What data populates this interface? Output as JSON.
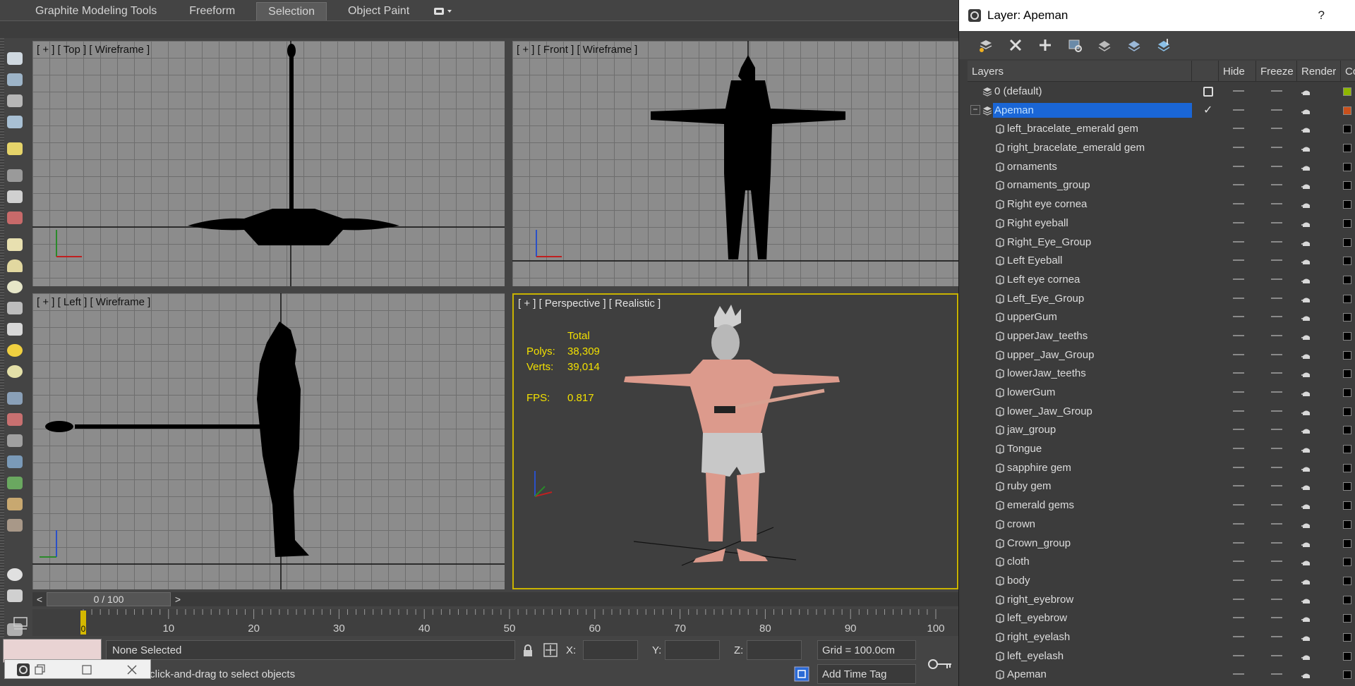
{
  "ribbon": {
    "tabs": [
      {
        "label": "Graphite Modeling Tools",
        "active": false
      },
      {
        "label": "Freeform",
        "active": false
      },
      {
        "label": "Selection",
        "active": true
      },
      {
        "label": "Object Paint",
        "active": false
      }
    ]
  },
  "viewports": {
    "top": {
      "label": "[ + ] [ Top ] [ Wireframe ]"
    },
    "front": {
      "label": "[ + ] [ Front ] [ Wireframe ]"
    },
    "left": {
      "label": "[ + ] [ Left ] [ Wireframe ]"
    },
    "perspective": {
      "label": "[ + ] [ Perspective ] [ Realistic ]",
      "stats": {
        "total_label": "Total",
        "polys_label": "Polys:",
        "polys": "38,309",
        "verts_label": "Verts:",
        "verts": "39,014",
        "fps_label": "FPS:",
        "fps": "0.817"
      }
    }
  },
  "timeline": {
    "slider_text": "0 / 100",
    "prev": "<",
    "next": ">",
    "ticks": [
      "0",
      "10",
      "20",
      "30",
      "40",
      "50",
      "60",
      "70",
      "80",
      "90",
      "100"
    ]
  },
  "status": {
    "selection": "None Selected",
    "prompt": "Click or click-and-drag to select objects",
    "x_label": "X:",
    "y_label": "Y:",
    "z_label": "Z:",
    "grid": "Grid = 100.0cm",
    "time_tag": "Add Time Tag"
  },
  "layer_explorer": {
    "title": "Layer: Apeman",
    "help": "?",
    "columns": {
      "layers": "Layers",
      "hide": "Hide",
      "freeze": "Freeze",
      "render": "Render",
      "color": "Colo"
    },
    "layers": [
      {
        "name": "0 (default)",
        "type": "layer",
        "color": "#8db600",
        "active_box": true
      },
      {
        "name": "Apeman",
        "type": "layer",
        "color": "#c8501c",
        "selected": true,
        "current": true
      },
      {
        "name": "left_bracelate_emerald gem",
        "type": "object",
        "color": "#000000"
      },
      {
        "name": "right_bracelate_emerald gem",
        "type": "object",
        "color": "#000000"
      },
      {
        "name": "ornaments",
        "type": "object",
        "color": "#000000"
      },
      {
        "name": "ornaments_group",
        "type": "object",
        "color": "#000000"
      },
      {
        "name": "Right eye cornea",
        "type": "object",
        "color": "#000000"
      },
      {
        "name": "Right eyeball",
        "type": "object",
        "color": "#000000"
      },
      {
        "name": "Right_Eye_Group",
        "type": "object",
        "color": "#000000"
      },
      {
        "name": "Left Eyeball",
        "type": "object",
        "color": "#000000"
      },
      {
        "name": "Left eye cornea",
        "type": "object",
        "color": "#000000"
      },
      {
        "name": "Left_Eye_Group",
        "type": "object",
        "color": "#000000"
      },
      {
        "name": "upperGum",
        "type": "object",
        "color": "#000000"
      },
      {
        "name": "upperJaw_teeths",
        "type": "object",
        "color": "#000000"
      },
      {
        "name": "upper_Jaw_Group",
        "type": "object",
        "color": "#000000"
      },
      {
        "name": "lowerJaw_teeths",
        "type": "object",
        "color": "#000000"
      },
      {
        "name": "lowerGum",
        "type": "object",
        "color": "#000000"
      },
      {
        "name": "lower_Jaw_Group",
        "type": "object",
        "color": "#000000"
      },
      {
        "name": "jaw_group",
        "type": "object",
        "color": "#000000"
      },
      {
        "name": "Tongue",
        "type": "object",
        "color": "#000000"
      },
      {
        "name": "sapphire gem",
        "type": "object",
        "color": "#000000"
      },
      {
        "name": "ruby gem",
        "type": "object",
        "color": "#000000"
      },
      {
        "name": "emerald gems",
        "type": "object",
        "color": "#000000"
      },
      {
        "name": "crown",
        "type": "object",
        "color": "#000000"
      },
      {
        "name": "Crown_group",
        "type": "object",
        "color": "#000000"
      },
      {
        "name": "cloth",
        "type": "object",
        "color": "#000000"
      },
      {
        "name": "body",
        "type": "object",
        "color": "#000000"
      },
      {
        "name": "right_eyebrow",
        "type": "object",
        "color": "#000000"
      },
      {
        "name": "left_eyebrow",
        "type": "object",
        "color": "#000000"
      },
      {
        "name": "right_eyelash",
        "type": "object",
        "color": "#000000"
      },
      {
        "name": "left_eyelash",
        "type": "object",
        "color": "#000000"
      },
      {
        "name": "Apeman",
        "type": "object",
        "color": "#000000"
      }
    ]
  },
  "colors": {
    "viewport_active_border": "#c9b300",
    "stats_text": "#f2e000",
    "selection_highlight": "#1a66d6"
  }
}
